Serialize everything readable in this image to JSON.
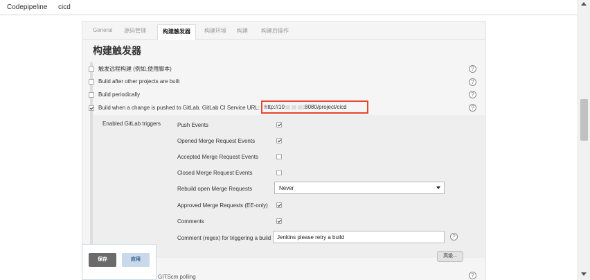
{
  "breadcrumb": [
    "Codepipeline",
    "cicd"
  ],
  "tabs": [
    "General",
    "源码管理",
    "构建触发器",
    "构建环境",
    "构建",
    "构建后操作"
  ],
  "active_tab_index": 2,
  "section_title": "构建触发器",
  "triggers": [
    {
      "label": "触发远程构建 (例如,使用脚本)",
      "checked": false
    },
    {
      "label": "Build after other projects are built",
      "checked": false
    },
    {
      "label": "Build periodically",
      "checked": false
    },
    {
      "label": "Build when a change is pushed to GitLab. GitLab CI Service URL:",
      "checked": true
    }
  ],
  "gitlab_url": {
    "prefix": "http://10",
    "suffix": ":8080/project/cicd"
  },
  "gitlab_subsection": {
    "label": "Enabled GitLab triggers",
    "items": [
      {
        "label": "Push Events",
        "checked": true
      },
      {
        "label": "Opened Merge Request Events",
        "checked": true
      },
      {
        "label": "Accepted Merge Request Events",
        "checked": false
      },
      {
        "label": "Closed Merge Request Events",
        "checked": false
      },
      {
        "label": "Rebuild open Merge Requests",
        "checked": null
      },
      {
        "label": "Approved Merge Requests (EE-only)",
        "checked": true
      },
      {
        "label": "Comments",
        "checked": true
      },
      {
        "label": "Comment (regex) for triggering a build",
        "checked": null
      }
    ],
    "rebuild_select_value": "Never",
    "comment_regex_value": "Jenkins please retry a build"
  },
  "advanced_button": "高级...",
  "save_button": "保存",
  "apply_button": "应用",
  "cutoff_row_text": "GITScm polling",
  "help_glyph": "?",
  "colors": {
    "highlight": "#e8432f",
    "save": "#6b6b6b",
    "apply_bg": "#c9d9ea"
  }
}
